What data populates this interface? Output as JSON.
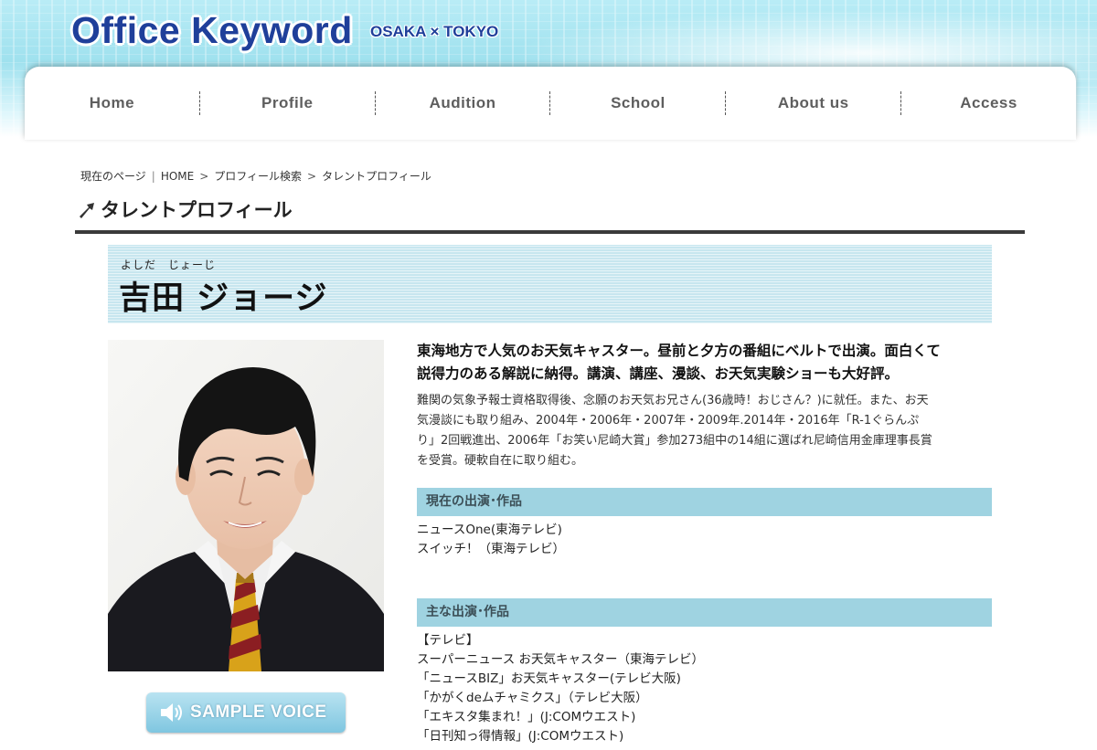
{
  "header": {
    "logo": "Office Keyword",
    "logo_sub": "OSAKA × TOKYO"
  },
  "nav": {
    "items": [
      "Home",
      "Profile",
      "Audition",
      "School",
      "About us",
      "Access"
    ]
  },
  "breadcrumb": {
    "label": "現在のページ",
    "separator": "|",
    "items": [
      "HOME",
      "プロフィール検索",
      "タレントプロフィール"
    ]
  },
  "page": {
    "title": "タレントプロフィール"
  },
  "profile": {
    "name_ruby": "よしだ　じょーじ",
    "name": "吉田 ジョージ",
    "sample_voice": "SAMPLE VOICE",
    "lead_lines": [
      "東海地方で人気のお天気キャスター。昼前と夕方の番組にベルトで出演。面白くて",
      "説得力のある解説に納得。講演、講座、漫談、お天気実験ショーも大好評。"
    ],
    "desc_lines": [
      "難関の気象予報士資格取得後、念願のお天気お兄さん(36歳時！おじさん？)に就任。また、お天",
      "気漫談にも取り組み、2004年・2006年・2007年・2009年.2014年・2016年「R-1ぐらんぷ",
      "り」2回戦進出、2006年「お笑い尼崎大賞」参加273組中の14組に選ばれ尼崎信用金庫理事長賞",
      "を受賞。硬軟自在に取り組む。"
    ]
  },
  "current_works": {
    "heading": "現在の出演･作品",
    "items": [
      "ニュースOne(東海テレビ)",
      "スイッチ！（東海テレビ）"
    ]
  },
  "main_works": {
    "heading": "主な出演･作品",
    "category": "【テレビ】",
    "items": [
      "スーパーニュース お天気キャスター（東海テレビ）",
      "「ニュースBIZ」お天気キャスター(テレビ大阪)",
      "「かがくdeムチャミクス」（テレビ大阪）",
      "「エキスタ集まれ！」(J:COMウエスト)",
      "「日刊知っ得情報」(J:COMウエスト)"
    ]
  },
  "colors": {
    "logo_blue": "#1f3f9a",
    "section_bg": "#9fd3e1",
    "banner_bg": "#c7e6ef"
  }
}
